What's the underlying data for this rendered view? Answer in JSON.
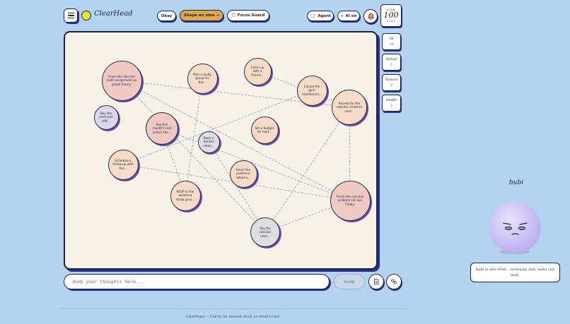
{
  "header": {
    "brand": "ClearHead",
    "okay_label": "Okay",
    "shape_label": "Shape an idea →",
    "focus_label": "Focus Guard",
    "agent_label": "Agent",
    "ai_label": "AI on",
    "load": {
      "label": "LOAD",
      "value": "100",
      "status": "Crisis"
    },
    "colors": {
      "accent": "#2a2f8a",
      "gold": "#e0a74a",
      "logo": "#e0e838",
      "background": "#b3d3f1"
    }
  },
  "nodes": [
    {
      "text": "Finish the discrete math assignment on graph theory.",
      "color": "pink"
    },
    {
      "text": "Plan a study group for the...",
      "color": "peach"
    },
    {
      "text": "Catch up with a friend...",
      "color": "peach"
    },
    {
      "text": "Cancel the gym membershi...",
      "color": "peach"
    },
    {
      "text": "Review for the calculus midterm next...",
      "color": "peach"
    },
    {
      "text": "Buy the prescripti refill...",
      "color": "lav"
    },
    {
      "text": "Pay this month's rent before the...",
      "color": "pink"
    },
    {
      "text": "Book a dentist clean...",
      "color": "grey"
    },
    {
      "text": "Set a budget for next...",
      "color": "peach"
    },
    {
      "text": "Schedule a follow-up with the...",
      "color": "peach"
    },
    {
      "text": "Email the professor about a...",
      "color": "peach"
    },
    {
      "text": "RSVP to the weekend study grou...",
      "color": "peach"
    },
    {
      "text": "Finish the calculus problem set due Friday.",
      "color": "pink"
    },
    {
      "text": "Pay the calculus tutor...",
      "color": "grey"
    }
  ],
  "categories": [
    {
      "label": "All",
      "count": "14"
    },
    {
      "label": "School",
      "count": "5"
    },
    {
      "label": "Finance",
      "count": "2"
    },
    {
      "label": "Health",
      "count": "2"
    }
  ],
  "input": {
    "placeholder": "dump your thoughts here...",
    "button": "dump"
  },
  "footer": "ClearHead — Clarity for anyone stuck on what's next",
  "mascot": {
    "name": "bubi",
    "message": "bubi is also tired... seriously, rest. tasks can wait."
  }
}
